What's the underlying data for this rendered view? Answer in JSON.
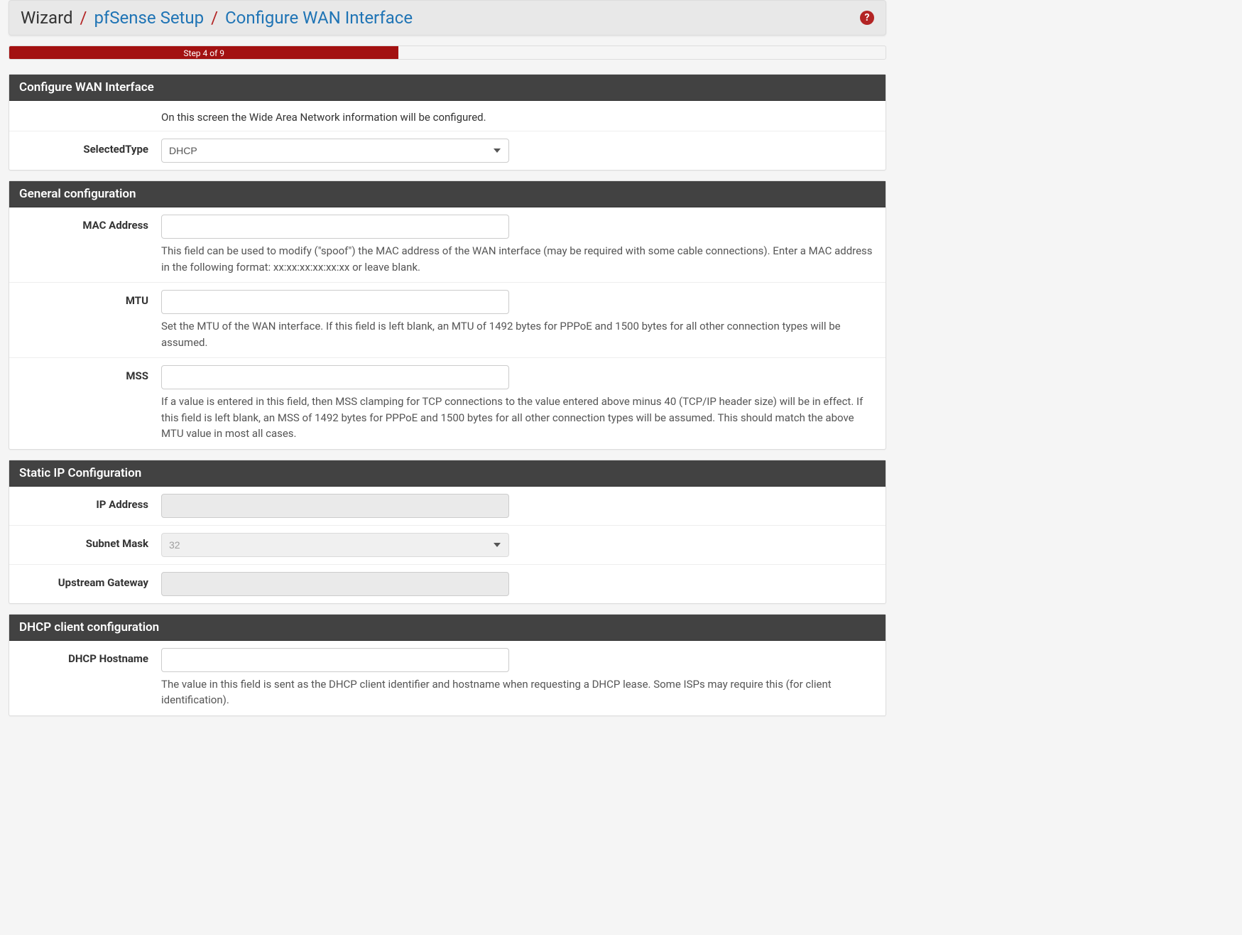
{
  "breadcrumb": {
    "root": "Wizard",
    "link1": "pfSense Setup",
    "link2": "Configure WAN Interface"
  },
  "help_icon_glyph": "?",
  "progress": {
    "label": "Step 4 of 9",
    "percent": 44.44
  },
  "panels": {
    "wan": {
      "title": "Configure WAN Interface",
      "intro": "On this screen the Wide Area Network information will be configured.",
      "selected_type": {
        "label": "SelectedType",
        "value": "DHCP"
      }
    },
    "general": {
      "title": "General configuration",
      "mac": {
        "label": "MAC Address",
        "value": "",
        "help": "This field can be used to modify (\"spoof\") the MAC address of the WAN interface (may be required with some cable connections). Enter a MAC address in the following format: xx:xx:xx:xx:xx:xx or leave blank."
      },
      "mtu": {
        "label": "MTU",
        "value": "",
        "help": "Set the MTU of the WAN interface. If this field is left blank, an MTU of 1492 bytes for PPPoE and 1500 bytes for all other connection types will be assumed."
      },
      "mss": {
        "label": "MSS",
        "value": "",
        "help": "If a value is entered in this field, then MSS clamping for TCP connections to the value entered above minus 40 (TCP/IP header size) will be in effect. If this field is left blank, an MSS of 1492 bytes for PPPoE and 1500 bytes for all other connection types will be assumed. This should match the above MTU value in most all cases."
      }
    },
    "staticip": {
      "title": "Static IP Configuration",
      "ip": {
        "label": "IP Address",
        "value": ""
      },
      "subnet": {
        "label": "Subnet Mask",
        "value": "32"
      },
      "gateway": {
        "label": "Upstream Gateway",
        "value": ""
      }
    },
    "dhcp": {
      "title": "DHCP client configuration",
      "hostname": {
        "label": "DHCP Hostname",
        "value": "",
        "help": "The value in this field is sent as the DHCP client identifier and hostname when requesting a DHCP lease. Some ISPs may require this (for client identification)."
      }
    }
  }
}
